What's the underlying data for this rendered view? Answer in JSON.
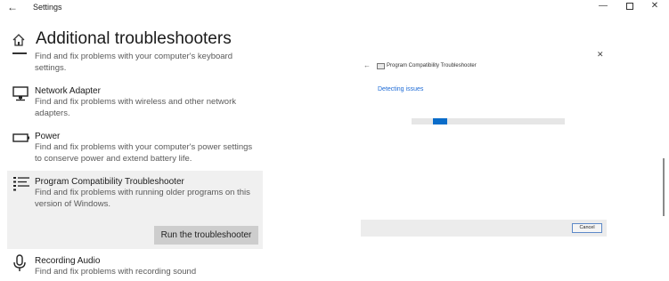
{
  "window": {
    "title": "Settings",
    "back_icon": "←",
    "minimize_icon": "—",
    "close_icon": "✕"
  },
  "header": {
    "title": "Additional troubleshooters"
  },
  "items": [
    {
      "icon": "keyboard-icon",
      "name": "",
      "desc_lines": [
        "Find and fix problems with your computer's keyboard",
        "settings."
      ]
    },
    {
      "icon": "network-adapter-icon",
      "name": "Network Adapter",
      "desc_lines": [
        "Find and fix problems with wireless and other network",
        "adapters."
      ]
    },
    {
      "icon": "power-icon",
      "name": "Power",
      "desc_lines": [
        "Find and fix problems with your computer's power settings",
        "to conserve power and extend battery life."
      ]
    },
    {
      "icon": "program-compatibility-icon",
      "name": "Program Compatibility Troubleshooter",
      "desc_lines": [
        "Find and fix problems with running older programs on this",
        "version of Windows."
      ],
      "selected": true,
      "button": "Run the troubleshooter"
    },
    {
      "icon": "microphone-icon",
      "name": "Recording Audio",
      "desc_lines": [
        "Find and fix problems with recording sound"
      ]
    }
  ],
  "dialog": {
    "close_icon": "✕",
    "back_icon": "←",
    "title": "Program Compatibility Troubleshooter",
    "status": "Detecting issues",
    "progress_indicator": {
      "start_fraction": 0.14,
      "end_fraction": 0.23
    },
    "cancel_label": "Cancel"
  },
  "colors": {
    "accent": "#0a6cc9",
    "status_text": "#1e6bd6",
    "selected_bg": "#f0f0f0",
    "button_bg": "#cdcdcd"
  }
}
